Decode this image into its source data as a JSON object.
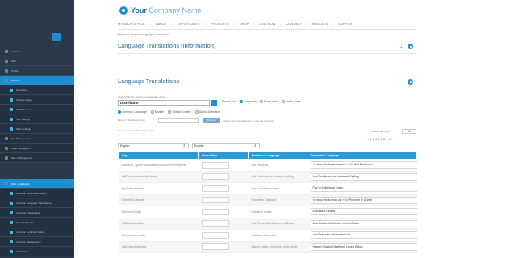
{
  "logo": {
    "brand": "Your",
    "brand_light": "Company Name"
  },
  "topnav": [
    "MY BACK OFFICE",
    "ABOUT",
    "OPPORTUNITY",
    "PRODUCTS",
    "SHOP",
    "JOIN NOW",
    "CONTACT",
    "MODULES",
    "SUPPORT"
  ],
  "sidebar": {
    "items": [
      {
        "label": "Contacts",
        "arrow": "‹"
      },
      {
        "label": "Mail",
        "arrow": "‹"
      },
      {
        "label": "Profile",
        "arrow": "‹"
      },
      {
        "label": "Website",
        "arrow": "∨"
      },
      {
        "label": "Home Text",
        "arrow": ""
      },
      {
        "label": "Change Image",
        "arrow": ""
      },
      {
        "label": "Public Content",
        "arrow": ""
      },
      {
        "label": "Site Settings",
        "arrow": ""
      },
      {
        "label": "SEO Settings",
        "arrow": ""
      },
      {
        "label": "Site Management",
        "arrow": "‹"
      },
      {
        "label": "Page Management",
        "arrow": "‹"
      },
      {
        "label": "Menu Management",
        "arrow": "‹"
      },
      {
        "label": "Web Localization",
        "arrow": "∨"
      },
      {
        "label": "Common Localization Setup",
        "arrow": ""
      },
      {
        "label": "Common Language Translations",
        "arrow": ""
      },
      {
        "label": "Common Translations",
        "arrow": ""
      },
      {
        "label": "Country Set Ups",
        "arrow": ""
      },
      {
        "label": "Common Localized Values",
        "arrow": ""
      },
      {
        "label": "Common Management",
        "arrow": ""
      },
      {
        "label": "Global Item",
        "arrow": ""
      }
    ]
  },
  "breadcrumb": "Home > Common Language Localization",
  "section_info": {
    "title": "Language Translations (Information)",
    "arrow_icon": "↓"
  },
  "section_main": {
    "title": "Language Translations"
  },
  "search": {
    "label": "Search/Filter by Reference Language Value",
    "value": "Distributor",
    "search_for_label": "Search For:",
    "options": [
      "Anywhere",
      "Exact Word",
      "Match Case"
    ]
  },
  "filters": [
    "Common Language",
    "Module",
    "Global Content",
    "Global Definition"
  ],
  "filter_prefix": "Filter on \"Distributor\" with",
  "apply_label": "Refresh",
  "apply_hint": "Click on the Refresh button to see the changes",
  "results_text": "Our Cases Were Showing 1 - 10",
  "pagination": {
    "per_page_label": "Results per Page",
    "per_page_value": "10",
    "pages": "« 1 2 3 4 5 6 » ⏭"
  },
  "selects": {
    "left": "English",
    "right": "English"
  },
  "table": {
    "headers": [
      "Key",
      "Description",
      "Reference Language",
      "Translated Language"
    ],
    "rows": [
      {
        "key": "Distributor_TypeOfYouDistributorSponsor ExclRegistered",
        "ref": "Add Distributor",
        "trans": "<i class=\"fa fa-plus-square\"></i> Add Distributor"
      },
      {
        "key": "AddDistributorAutomaticSpilling",
        "ref": "Add Distributor via Automatic Spilling",
        "trans": "Add Distributor via Automatic Spilling"
      },
      {
        "key": "PayDistributorSales",
        "ref": "Pay on Distributor Sales",
        "trans": "Pay on Distributor Sales"
      },
      {
        "key": "Promote To Member",
        "ref": "Promote to Distributor",
        "trans": "<i class=\"fa fa-level-up\"></i> Promote to Distrib"
      },
      {
        "key": "DistributorDetails",
        "ref": "Distributor Details",
        "trans": "Distributor Details"
      },
      {
        "key": "AddDistributorBelow",
        "ref": "Add Charter Distributor Levels Below",
        "trans": "Add Charter Distributor Levels Below"
      },
      {
        "key": "DistributorInformation",
        "ref": "Distributor Information",
        "trans": "<b>Distributor Information</b>"
      },
      {
        "key": "AddCharterDistributor",
        "ref": "Search Charter Distributor Levels Below",
        "trans": "Search Charter Distributor Levels Below"
      }
    ]
  }
}
